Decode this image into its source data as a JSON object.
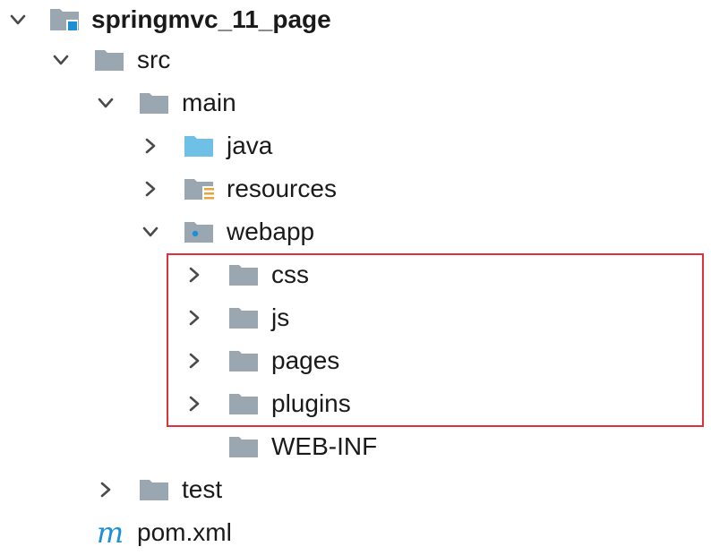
{
  "tree": {
    "project": {
      "label": "springmvc_11_page",
      "icon": "module-folder-icon",
      "expanded": true
    },
    "src": {
      "label": "src",
      "icon": "folder-icon",
      "expanded": true
    },
    "main": {
      "label": "main",
      "icon": "folder-icon",
      "expanded": true
    },
    "java": {
      "label": "java",
      "icon": "source-root-folder-icon",
      "expanded": false
    },
    "resources": {
      "label": "resources",
      "icon": "resources-root-folder-icon",
      "expanded": false
    },
    "webapp": {
      "label": "webapp",
      "icon": "web-folder-icon",
      "expanded": true
    },
    "css": {
      "label": "css",
      "icon": "folder-icon",
      "expanded": false
    },
    "js": {
      "label": "js",
      "icon": "folder-icon",
      "expanded": false
    },
    "pages": {
      "label": "pages",
      "icon": "folder-icon",
      "expanded": false
    },
    "plugins": {
      "label": "plugins",
      "icon": "folder-icon",
      "expanded": false
    },
    "webinf": {
      "label": "WEB-INF",
      "icon": "folder-icon"
    },
    "test": {
      "label": "test",
      "icon": "folder-icon",
      "expanded": false
    },
    "pom": {
      "label": "pom.xml",
      "icon": "maven-m-icon",
      "glyph": "m"
    }
  },
  "colors": {
    "folder": "#9aa7b0",
    "source_folder": "#6fc0e6",
    "accent_blue": "#1c8fd6",
    "resources_marker": "#e8a33d",
    "highlight_border": "#e0323c",
    "chevron": "#4a4a4a"
  }
}
